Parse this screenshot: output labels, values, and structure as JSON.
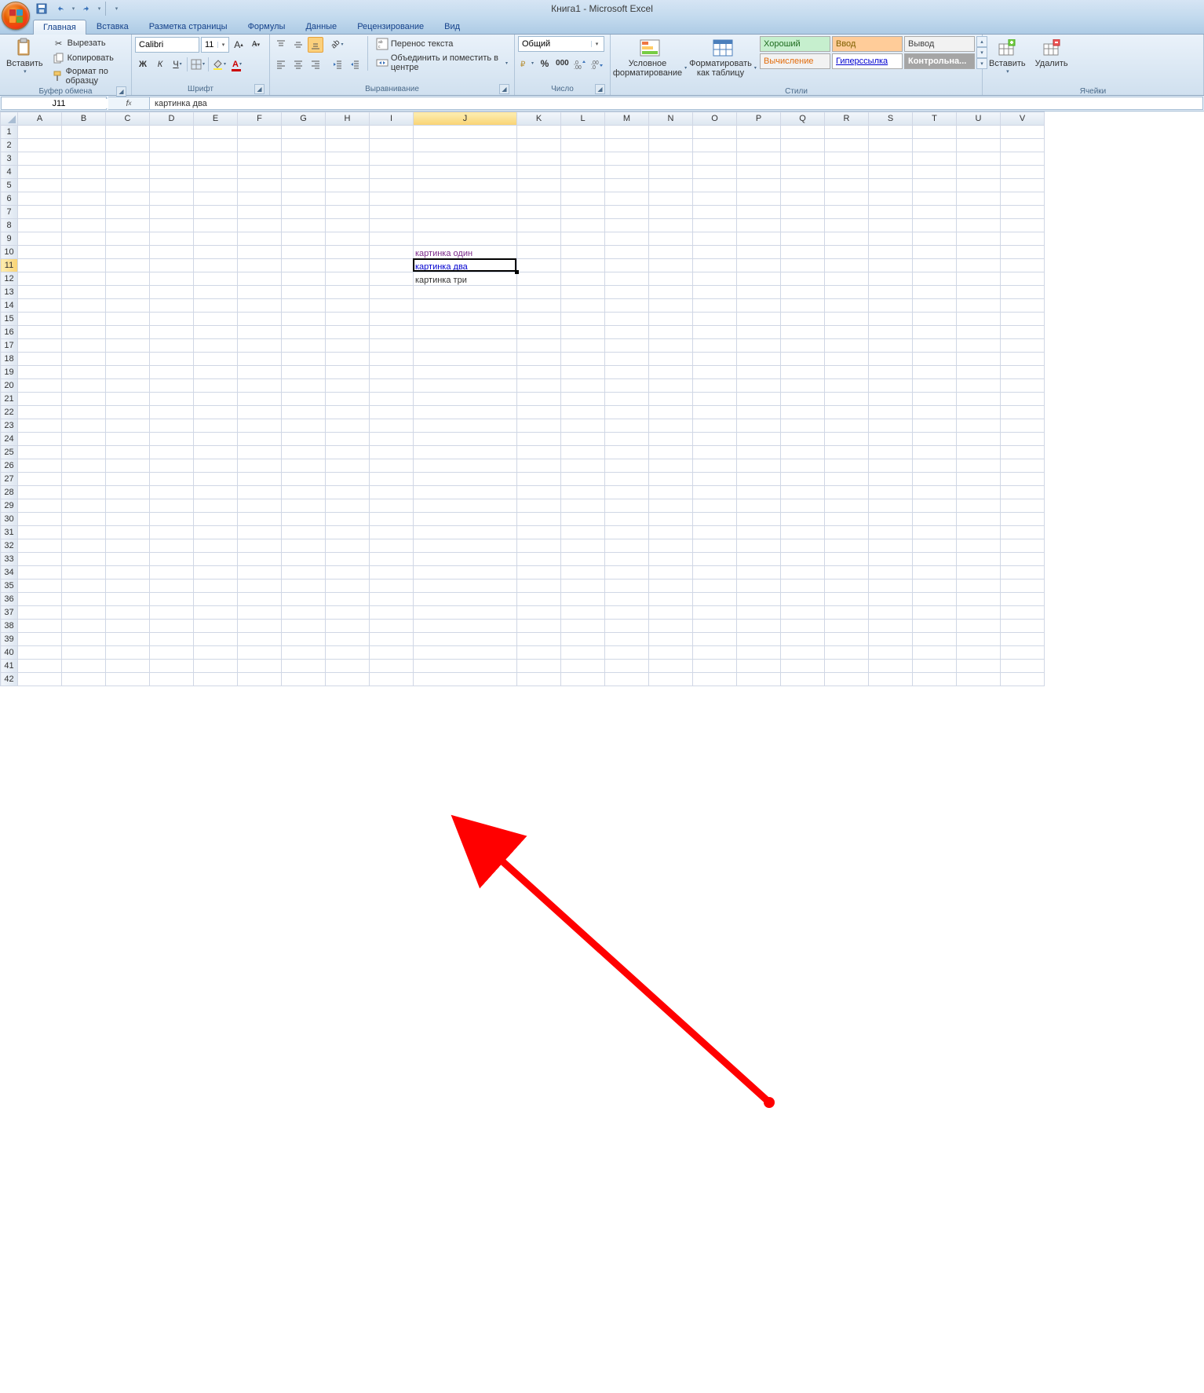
{
  "app": {
    "title": "Книга1 - Microsoft Excel"
  },
  "qat": {
    "save": "save-icon",
    "undo": "undo-icon",
    "redo": "redo-icon"
  },
  "tabs": [
    "Главная",
    "Вставка",
    "Разметка страницы",
    "Формулы",
    "Данные",
    "Рецензирование",
    "Вид"
  ],
  "active_tab_index": 0,
  "ribbon": {
    "clipboard": {
      "title": "Буфер обмена",
      "paste": "Вставить",
      "cut": "Вырезать",
      "copy": "Копировать",
      "format_painter": "Формат по образцу"
    },
    "font": {
      "title": "Шрифт",
      "name": "Calibri",
      "size": "11"
    },
    "alignment": {
      "title": "Выравнивание",
      "wrap": "Перенос текста",
      "merge": "Объединить и поместить в центре"
    },
    "number": {
      "title": "Число",
      "format": "Общий"
    },
    "styles": {
      "title": "Стили",
      "cond": "Условное форматирование",
      "table": "Форматировать как таблицу",
      "cells": [
        {
          "label": "Хороший",
          "bg": "#c6efce",
          "fg": "#1e6b1e"
        },
        {
          "label": "Ввод",
          "bg": "#ffcc99",
          "fg": "#7f6000"
        },
        {
          "label": "Вывод",
          "bg": "#f2f2f2",
          "fg": "#3f3f3f"
        },
        {
          "label": "Вычисление",
          "bg": "#f2f2f2",
          "fg": "#e26b0a"
        },
        {
          "label": "Гиперссылка",
          "bg": "#ffffff",
          "fg": "#0000d0"
        },
        {
          "label": "Контрольна...",
          "bg": "#a5a5a5",
          "fg": "#ffffff"
        }
      ]
    },
    "cells_group": {
      "title": "Ячейки",
      "insert": "Вставить",
      "delete": "Удалить"
    }
  },
  "namebox": "J11",
  "formula": "картинка два",
  "columns": [
    "A",
    "B",
    "C",
    "D",
    "E",
    "F",
    "G",
    "H",
    "I",
    "J",
    "K",
    "L",
    "M",
    "N",
    "O",
    "P",
    "Q",
    "R",
    "S",
    "T",
    "U",
    "V"
  ],
  "row_count": 42,
  "selected": {
    "col": "J",
    "row": 11
  },
  "cells": {
    "J10": {
      "value": "картинка один",
      "style": "visitedlink"
    },
    "J11": {
      "value": "картинка два",
      "style": "hyperlink"
    },
    "J12": {
      "value": "картинка три",
      "style": ""
    }
  },
  "col_widths": {
    "default": 56,
    "J": 132
  }
}
